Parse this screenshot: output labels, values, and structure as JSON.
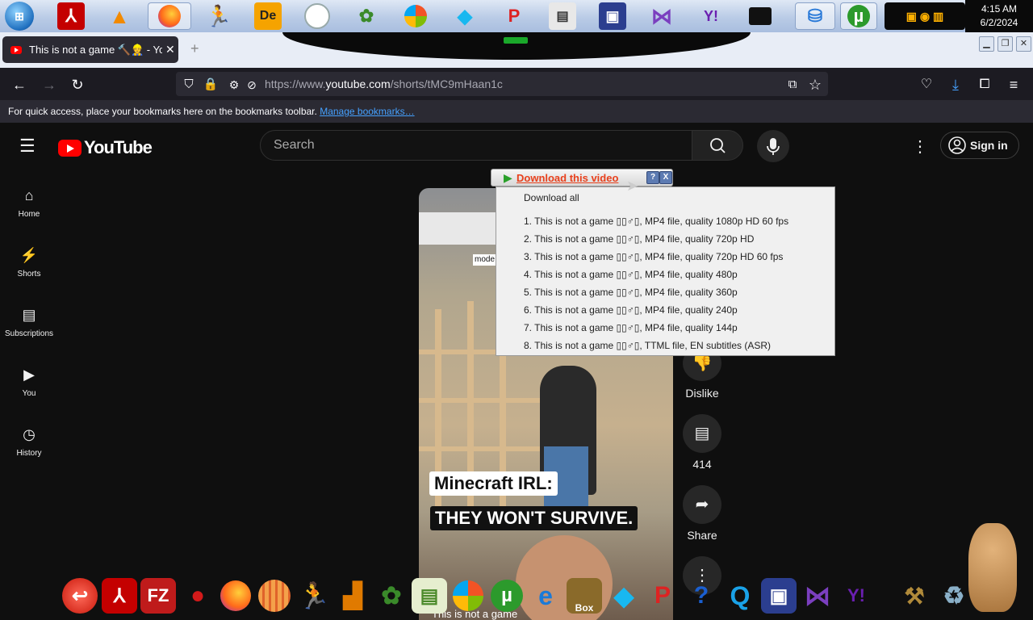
{
  "taskbar": {
    "clock_time": "4:15 AM",
    "clock_date": "6/2/2024",
    "icons": [
      "windows-start-icon",
      "acrobat-icon",
      "vlc-icon",
      "firefox-icon",
      "aim-icon",
      "de-icon",
      "clock-icon",
      "plant-icon",
      "windows-logo-icon",
      "diamond-icon",
      "pidgin-icon",
      "remote-desktop-icon",
      "vmware-icon",
      "visual-studio-icon",
      "yahoo-messenger-icon",
      "black-box-icon",
      "network-icon",
      "utorrent-icon"
    ]
  },
  "browser": {
    "tab_title": "This is not a game 🔨👷 - YouTu",
    "url_prefix": "https://www.",
    "url_host": "youtube.com",
    "url_path": "/shorts/tMC9mHaan1c",
    "bookmarks_text": "For quick access, place your bookmarks here on the bookmarks toolbar.",
    "bookmarks_link": "Manage bookmarks…"
  },
  "youtube": {
    "logo_text": "YouTube",
    "search_placeholder": "Search",
    "sign_in": "Sign in",
    "sidebar": [
      {
        "label": "Home",
        "icon": "home-icon"
      },
      {
        "label": "Shorts",
        "icon": "shorts-icon"
      },
      {
        "label": "Subscriptions",
        "icon": "subscriptions-icon"
      },
      {
        "label": "You",
        "icon": "you-icon"
      },
      {
        "label": "History",
        "icon": "history-icon"
      }
    ],
    "video": {
      "caption1": "Minecraft IRL:",
      "caption2": "THEY WON'T SURVIVE.",
      "overlay_text": "mode won't",
      "bottom_title": "This is not a game"
    },
    "actions": {
      "dislike": "Dislike",
      "comments": "414",
      "share": "Share"
    }
  },
  "download_popup": {
    "title": "Download this video",
    "help": "?",
    "close": "X",
    "download_all": "Download all",
    "items": [
      "1.  This is not a game ▯▯♂▯,  MP4 file, quality 1080p HD 60 fps",
      "2.  This is not a game ▯▯♂▯,  MP4 file, quality 720p HD",
      "3.  This is not a game ▯▯♂▯,  MP4 file, quality 720p HD 60 fps",
      "4.  This is not a game ▯▯♂▯,  MP4 file, quality 480p",
      "5.  This is not a game ▯▯♂▯,  MP4 file, quality 360p",
      "6.  This is not a game ▯▯♂▯,  MP4 file, quality 240p",
      "7.  This is not a game ▯▯♂▯,  MP4 file, quality 144p",
      "8.  This is not a game ▯▯♂▯,  TTML file, EN subtitles (ASR)"
    ]
  },
  "dock": {
    "box_label": "Box",
    "icons": [
      "reply-icon",
      "acrobat-icon",
      "filezilla-icon",
      "red-creature-icon",
      "firefox-icon",
      "opera-icon",
      "aim-icon",
      "zip-icon",
      "plant-icon",
      "notes-icon",
      "windows-logo-icon",
      "utorrent-icon",
      "ie-icon",
      "box-icon",
      "diamond-icon",
      "pidgin-icon",
      "help-icon",
      "quicktime-icon",
      "vmware-icon",
      "visual-studio-icon",
      "yahoo-messenger-icon",
      "tools-icon",
      "recycle-bin-icon",
      "hamster-icon"
    ]
  }
}
